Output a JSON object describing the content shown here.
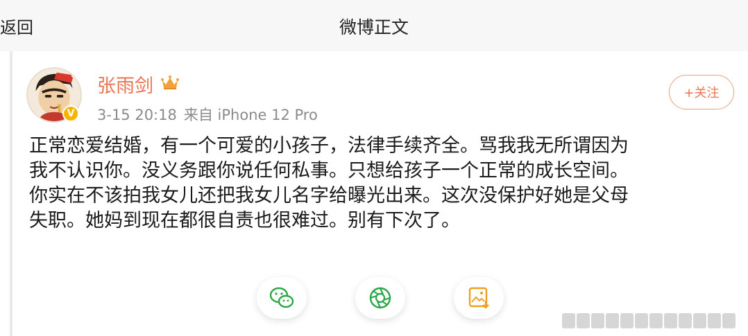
{
  "nav": {
    "back_label": "返回",
    "title": "微博正文"
  },
  "post": {
    "author": "张雨剑",
    "date": "3-15 20:18",
    "source": "来自 iPhone 12 Pro",
    "follow_label": "+关注",
    "verified_badge": "V",
    "lines": [
      "正常恋爱结婚，有一个可爱的小孩子，法律手续齐全。骂我我无所谓因为",
      "我不认识你。没义务跟你说任何私事。只想给孩子一个正常的成长空间。",
      "你实在不该拍我女儿还把我女儿名字给曝光出来。这次没保护好她是父母",
      "失职。她妈到现在都很自责也很难过。别有下次了。"
    ]
  },
  "share": [
    {
      "icon": "wechat-icon",
      "color": "#2aa745"
    },
    {
      "icon": "moments-icon",
      "color": "#2aa745"
    },
    {
      "icon": "save-image-icon",
      "color": "#f0a020"
    }
  ],
  "colors": {
    "accent": "#eb7350",
    "meta": "#8a8a8a",
    "topbar": "#f7f7f7"
  }
}
